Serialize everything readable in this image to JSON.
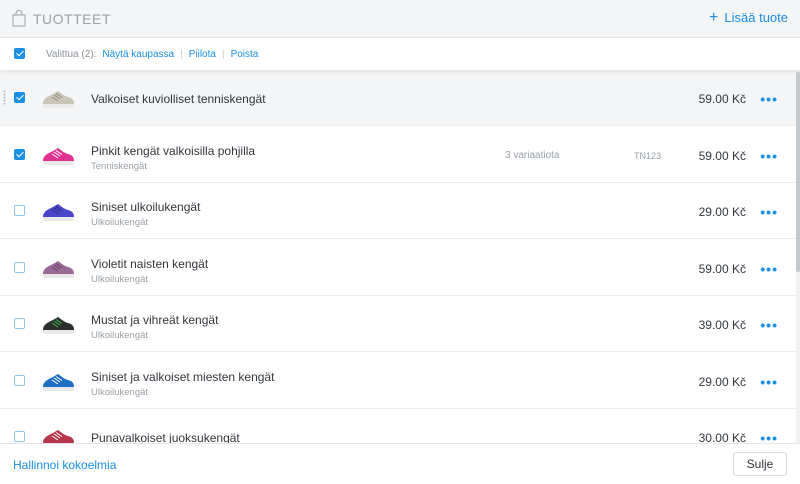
{
  "header": {
    "title": "TUOTTEET",
    "add_label": "Lisää tuote",
    "add_icon": "+"
  },
  "toolbar": {
    "selected_label": "Valittua (2):",
    "show_in_store": "Näytä kaupassa",
    "hide": "Piilota",
    "delete": "Poista",
    "all_checked": true
  },
  "products": [
    {
      "name": "Valkoiset kuviolliset tenniskengät",
      "category": "",
      "variants": "",
      "sku": "",
      "price": "59.00 Kč",
      "checked": true,
      "shoe_color": "#c9c6b8",
      "accent": "#8f8c7a"
    },
    {
      "name": "Pinkit kengät valkoisilla pohjilla",
      "category": "Tenniskengät",
      "variants": "3 variaatiota",
      "sku": "TN123",
      "price": "59.00 Kč",
      "checked": true,
      "shoe_color": "#e0338f",
      "accent": "#ffffff"
    },
    {
      "name": "Siniset ulkoilukengät",
      "category": "Ulkoilukengät",
      "variants": "",
      "sku": "",
      "price": "29.00 Kč",
      "checked": false,
      "shoe_color": "#4a46c9",
      "accent": "#2c2a8a"
    },
    {
      "name": "Violetit naisten kengät",
      "category": "Ulkoilukengät",
      "variants": "",
      "sku": "",
      "price": "59.00 Kč",
      "checked": false,
      "shoe_color": "#9a6a98",
      "accent": "#6b4468"
    },
    {
      "name": "Mustat ja vihreät kengät",
      "category": "Ulkoilukengät",
      "variants": "",
      "sku": "",
      "price": "39.00 Kč",
      "checked": false,
      "shoe_color": "#2a2f2c",
      "accent": "#3fb34a"
    },
    {
      "name": "Siniset ja valkoiset miesten kengät",
      "category": "Ulkoilukengät",
      "variants": "",
      "sku": "",
      "price": "29.00 Kč",
      "checked": false,
      "shoe_color": "#1f6fc4",
      "accent": "#ffffff"
    },
    {
      "name": "Punavalkoiset juoksukengät",
      "category": "",
      "variants": "",
      "sku": "",
      "price": "30.00 Kč",
      "checked": false,
      "shoe_color": "#b8364a",
      "accent": "#ffffff"
    }
  ],
  "more_icon": "•••",
  "footer": {
    "manage_collections": "Hallinnoi kokoelmia",
    "close_label": "Sulje"
  },
  "colors": {
    "accent": "#1a8fe3",
    "header_bg": "#f4f5f6"
  }
}
